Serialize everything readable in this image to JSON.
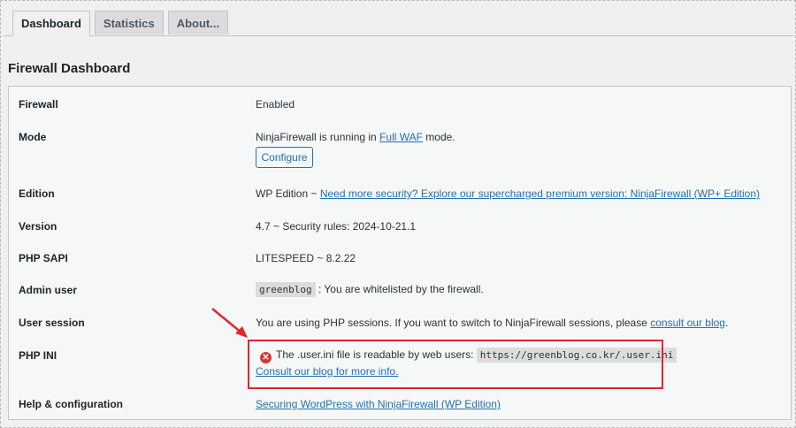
{
  "tabs": [
    {
      "label": "Dashboard"
    },
    {
      "label": "Statistics"
    },
    {
      "label": "About..."
    }
  ],
  "page_title": "Firewall Dashboard",
  "rows": {
    "firewall": {
      "label": "Firewall",
      "value": "Enabled"
    },
    "mode": {
      "label": "Mode",
      "prefix": "NinjaFirewall is running in ",
      "link": "Full WAF",
      "suffix": " mode.",
      "button": "Configure"
    },
    "edition": {
      "label": "Edition",
      "prefix": "WP Edition ~ ",
      "link": "Need more security? Explore our supercharged premium version: NinjaFirewall (WP+ Edition)"
    },
    "version": {
      "label": "Version",
      "value": "4.7 ~ Security rules: 2024-10-21.1"
    },
    "php_sapi": {
      "label": "PHP SAPI",
      "value": "LITESPEED ~ 8.2.22"
    },
    "admin_user": {
      "label": "Admin user",
      "code": "greenblog",
      "suffix": " : You are whitelisted by the firewall."
    },
    "user_session": {
      "label": "User session",
      "prefix": "You are using PHP sessions. If you want to switch to NinjaFirewall sessions, please ",
      "link": "consult our blog",
      "suffix": "."
    },
    "php_ini": {
      "label": "PHP INI",
      "icon": "error-icon",
      "message": "The .user.ini file is readable by web users: ",
      "code": "https://greenblog.co.kr/.user.ini",
      "link": "Consult our blog for more info."
    },
    "help": {
      "label": "Help & configuration",
      "link": "Securing WordPress with NinjaFirewall (WP Edition)"
    }
  },
  "colors": {
    "link": "#2271b1",
    "annotation": "#e0262f",
    "error": "#d63638"
  }
}
